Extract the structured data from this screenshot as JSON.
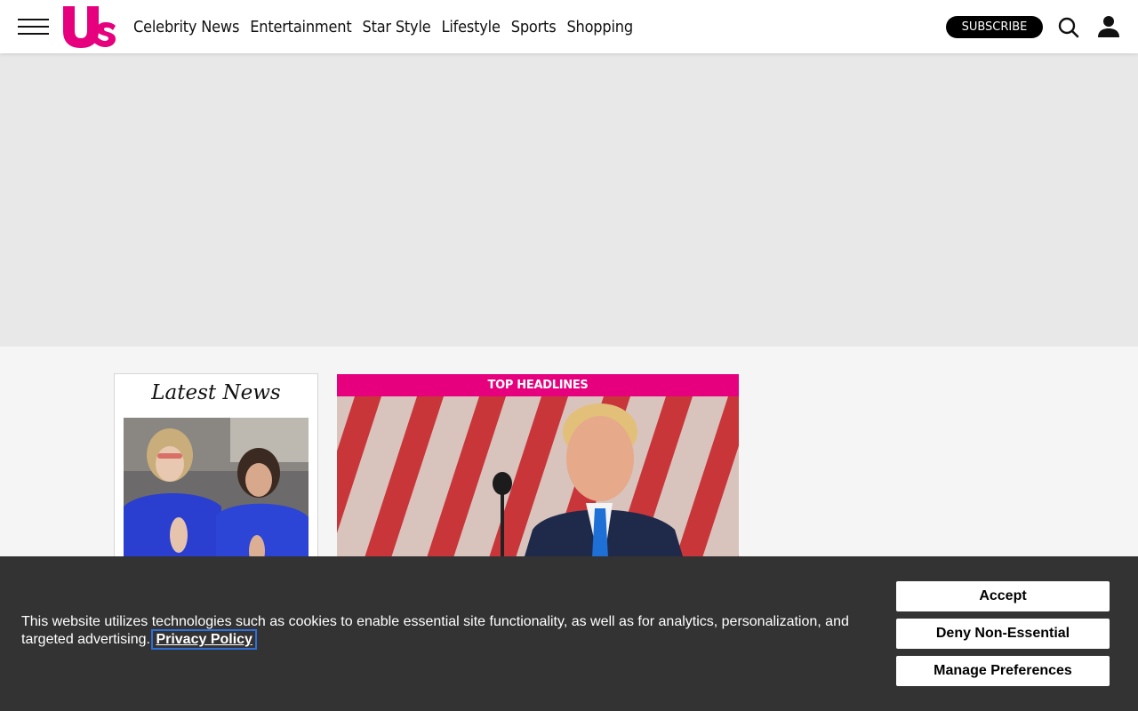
{
  "header": {
    "logo_text": "Us",
    "nav": [
      "Celebrity News",
      "Entertainment",
      "Star Style",
      "Lifestyle",
      "Sports",
      "Shopping"
    ],
    "subscribe_label": "SUBSCRIBE"
  },
  "latest_news": {
    "title": "Latest News"
  },
  "top_headlines": {
    "label": "TOP HEADLINES"
  },
  "cookie_banner": {
    "text": "This website utilizes technologies such as cookies to enable essential site functionality, as well as for analytics, personalization, and targeted advertising.",
    "privacy_link": "Privacy Policy",
    "accept_label": "Accept",
    "deny_label": "Deny Non-Essential",
    "manage_label": "Manage Preferences"
  },
  "colors": {
    "brand_pink": "#e6007e",
    "banner_bg": "#333333"
  }
}
